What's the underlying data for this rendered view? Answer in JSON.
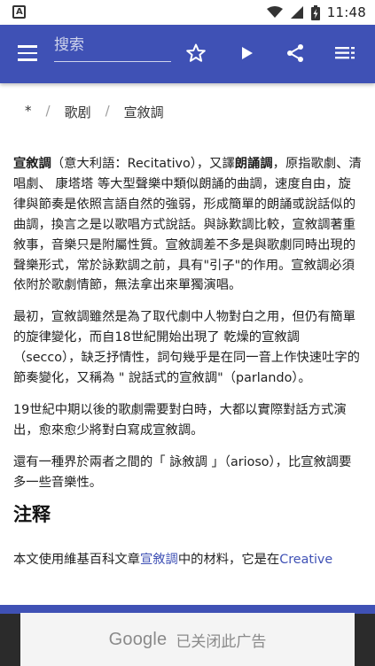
{
  "status_bar": {
    "time": "11:48"
  },
  "toolbar": {
    "search_placeholder": "搜索"
  },
  "breadcrumb": [
    "*",
    "歌剧",
    "宣敘調"
  ],
  "article": {
    "p1": {
      "term": "宣敘調",
      "a": "（意大利語：Recitativo），又譯",
      "term2": "朗誦調",
      "b": "，原指歌劇、清唱劇、 康塔塔 等大型聲樂中類似朗誦的曲調，速度自由，旋律與節奏是依照言語自然的強弱，形成簡單的朗誦或說話似的曲調，換言之是以歌唱方式說話。與詠歎調比較，宣敘調著重敘事，音樂只是附屬性質。宣敘調差不多是與歌劇同時出現的聲樂形式，常於詠歎調之前，具有\"引子\"的作用。宣敘調必須依附於歌劇情節，無法拿出來單獨演唱。"
    },
    "p2": "最初，宣敘調雖然是為了取代劇中人物對白之用，但仍有簡單的旋律變化，而自18世紀開始出現了 乾燥的宣敘調（secco），缺乏抒情性，詞句幾乎是在同一音上作快速吐字的節奏變化，又稱為 \" 說話式的宣敘調\"（parlando）。",
    "p3": "19世紀中期以後的歌劇需要對白時，大都以實際對話方式演出，愈來愈少將對白寫成宣敘調。",
    "p4": "還有一種界於兩者之間的「 詠敘調 」（arioso），比宣敘調要多一些音樂性。",
    "heading": "注释",
    "attribution": {
      "a": "本文使用維基百科文章",
      "link": "宣敘調",
      "b": "中的材料，它是在",
      "link2": "Creative"
    }
  },
  "ad": {
    "brand": "Google",
    "text": "已关闭此广告"
  },
  "colors": {
    "primary": "#3f51b5",
    "link": "#3f51b5"
  },
  "icons": [
    "menu-icon",
    "star-icon",
    "play-icon",
    "share-icon",
    "playlist-icon"
  ]
}
